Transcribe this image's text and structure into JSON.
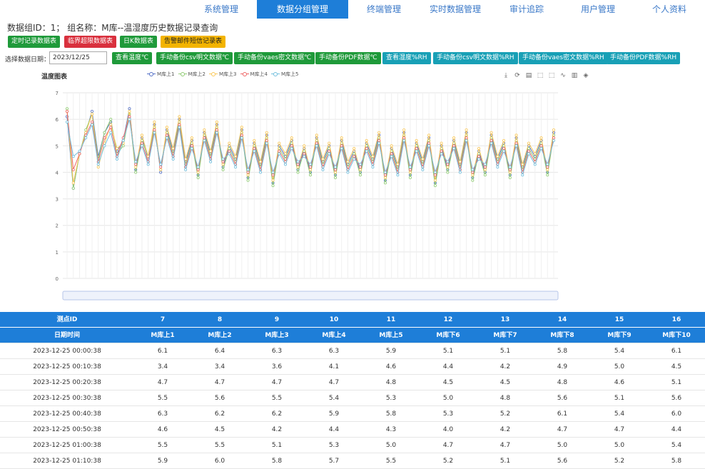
{
  "nav": [
    {
      "label": "系统管理",
      "active": false
    },
    {
      "label": "数据分组管理",
      "active": true
    },
    {
      "label": "终端管理",
      "active": false
    },
    {
      "label": "实时数据管理",
      "active": false
    },
    {
      "label": "审计追踪",
      "active": false
    },
    {
      "label": "用户管理",
      "active": false
    },
    {
      "label": "个人资料",
      "active": false
    }
  ],
  "header": {
    "title": "数据组ID：1；  组名称：M库--温湿度历史数据记录查询"
  },
  "buttons_row1": [
    {
      "label": "定时记录数据表",
      "color": "green"
    },
    {
      "label": "临界超限数据表",
      "color": "red"
    },
    {
      "label": "日K数据表",
      "color": "green"
    },
    {
      "label": "告警邮件短信记录表",
      "color": "yellow"
    }
  ],
  "date_label": "选择数据日期：",
  "date_value": "2023/12/25",
  "buttons_row2": [
    {
      "label": "查看温度℃",
      "color": "green"
    },
    {
      "label": "手动备份csv明文数据℃",
      "color": "green"
    },
    {
      "label": "手动备份vaes密文数据℃",
      "color": "green"
    },
    {
      "label": "手动备份PDF数据℃",
      "color": "green"
    },
    {
      "label": "查看湿度%RH",
      "color": "teal"
    },
    {
      "label": "手动备份csv明文数据%RH",
      "color": "teal"
    },
    {
      "label": "手动备份vaes密文数据%RH",
      "color": "teal"
    },
    {
      "label": "手动备份PDF数据%RH",
      "color": "teal"
    }
  ],
  "toolbox_icons": [
    "download-icon",
    "refresh-icon",
    "data-view-icon",
    "zoom-icon",
    "zoom-reset-icon",
    "line-chart-icon",
    "bar-chart-icon",
    "stack-icon"
  ],
  "chart_data": {
    "type": "line",
    "title": "温度图表",
    "ylim": [
      0,
      7
    ],
    "yticks": [
      0,
      1,
      2,
      3,
      4,
      5,
      6,
      7
    ],
    "grid": true,
    "legend_position": "top",
    "series": [
      {
        "name": "M库上1",
        "color": "#5470c6",
        "values": [
          6.1,
          3.4,
          4.7,
          5.5,
          6.3,
          4.6,
          5.5,
          5.9,
          4.8,
          5.2,
          6.4,
          4.1,
          5.3,
          4.5,
          5.8,
          4.0,
          5.6,
          4.8,
          6.0,
          4.4,
          5.2,
          3.9,
          5.5,
          4.7,
          5.8,
          4.2,
          5.0,
          4.5,
          5.6,
          3.8,
          5.1,
          4.3,
          5.4,
          3.6,
          5.0,
          4.6,
          5.2,
          4.1,
          4.9,
          4.0,
          5.3,
          4.4,
          5.0,
          3.9,
          5.2,
          4.3,
          4.8,
          4.0,
          5.1,
          4.5,
          5.4,
          3.7,
          4.9,
          4.2,
          5.5,
          3.9,
          5.1,
          4.4,
          5.3,
          3.6,
          5.0,
          4.1,
          5.2,
          4.3,
          5.5,
          3.8,
          4.8,
          4.0,
          5.4,
          4.5,
          5.1,
          3.9,
          5.3,
          4.2,
          5.0,
          4.6,
          5.2,
          4.0,
          5.5
        ]
      },
      {
        "name": "M库上2",
        "color": "#91cc75",
        "values": [
          6.4,
          3.4,
          4.7,
          5.6,
          6.2,
          4.5,
          5.5,
          6.0,
          4.7,
          5.0,
          6.2,
          4.0,
          5.2,
          4.6,
          5.7,
          4.1,
          5.5,
          4.7,
          5.9,
          4.3,
          5.1,
          3.8,
          5.4,
          4.6,
          5.7,
          4.1,
          4.9,
          4.4,
          5.5,
          3.7,
          5.0,
          4.2,
          5.3,
          3.5,
          4.9,
          4.5,
          5.1,
          4.0,
          4.8,
          3.9,
          5.2,
          4.3,
          4.9,
          3.8,
          5.1,
          4.2,
          4.7,
          3.9,
          5.0,
          4.4,
          5.3,
          3.6,
          4.8,
          4.1,
          5.4,
          3.8,
          5.0,
          4.3,
          5.2,
          3.5,
          4.9,
          4.0,
          5.1,
          4.2,
          5.4,
          3.7,
          4.7,
          3.9,
          5.3,
          4.4,
          5.0,
          3.8,
          5.2,
          4.1,
          4.9,
          4.5,
          5.1,
          3.9,
          5.4
        ]
      },
      {
        "name": "M库上3",
        "color": "#fac858",
        "values": [
          6.3,
          3.6,
          4.7,
          5.5,
          6.2,
          4.2,
          5.1,
          5.8,
          4.9,
          5.1,
          6.3,
          4.2,
          5.4,
          4.6,
          5.9,
          4.1,
          5.7,
          4.9,
          6.1,
          4.5,
          5.3,
          4.0,
          5.6,
          4.8,
          5.9,
          4.3,
          5.1,
          4.6,
          5.7,
          3.9,
          5.2,
          4.4,
          5.5,
          3.7,
          5.1,
          4.7,
          5.3,
          4.2,
          5.0,
          4.1,
          5.4,
          4.5,
          5.1,
          4.0,
          5.3,
          4.4,
          4.9,
          4.1,
          5.2,
          4.6,
          5.5,
          3.8,
          5.0,
          4.3,
          5.6,
          4.0,
          5.2,
          4.5,
          5.4,
          3.7,
          5.1,
          4.2,
          5.3,
          4.4,
          5.6,
          3.9,
          4.9,
          4.1,
          5.5,
          4.6,
          5.2,
          4.0,
          5.4,
          4.3,
          5.1,
          4.7,
          5.3,
          4.1,
          5.6
        ]
      },
      {
        "name": "M库上4",
        "color": "#ee6666",
        "values": [
          6.3,
          4.1,
          4.7,
          5.4,
          5.9,
          4.4,
          5.3,
          5.7,
          4.6,
          5.3,
          6.1,
          4.3,
          5.1,
          4.4,
          5.6,
          4.2,
          5.4,
          4.6,
          5.8,
          4.2,
          5.0,
          4.1,
          5.3,
          4.5,
          5.6,
          4.4,
          4.8,
          4.3,
          5.4,
          4.0,
          4.9,
          4.1,
          5.2,
          3.9,
          4.8,
          4.4,
          5.0,
          4.3,
          4.7,
          4.2,
          5.1,
          4.2,
          4.8,
          4.1,
          5.0,
          4.1,
          4.6,
          4.2,
          4.9,
          4.3,
          5.2,
          3.9,
          4.7,
          4.0,
          5.3,
          4.1,
          4.9,
          4.2,
          5.1,
          3.9,
          4.8,
          4.3,
          5.0,
          4.1,
          5.3,
          4.0,
          4.6,
          4.2,
          5.2,
          4.3,
          4.9,
          4.1,
          5.1,
          4.0,
          4.8,
          4.4,
          5.0,
          4.2,
          5.3
        ]
      },
      {
        "name": "M库上5",
        "color": "#73c0de",
        "values": [
          5.9,
          4.6,
          4.8,
          5.3,
          5.8,
          4.3,
          5.0,
          5.5,
          4.5,
          5.2,
          6.0,
          4.4,
          5.0,
          4.3,
          5.5,
          4.3,
          5.3,
          4.5,
          5.7,
          4.1,
          4.9,
          4.2,
          5.2,
          4.4,
          5.5,
          4.5,
          4.7,
          4.2,
          5.3,
          4.1,
          4.8,
          4.0,
          5.1,
          4.0,
          4.7,
          4.3,
          4.9,
          4.4,
          4.6,
          4.3,
          5.0,
          4.1,
          4.7,
          4.2,
          4.9,
          4.0,
          4.5,
          4.3,
          4.8,
          4.2,
          5.1,
          4.0,
          4.6,
          3.9,
          5.2,
          4.2,
          4.8,
          4.1,
          5.0,
          4.0,
          4.7,
          4.4,
          4.9,
          4.0,
          5.2,
          4.1,
          4.5,
          4.3,
          5.1,
          4.2,
          4.8,
          4.2,
          5.0,
          3.9,
          4.7,
          4.3,
          4.9,
          4.3,
          5.2
        ]
      }
    ]
  },
  "table": {
    "id_header_label": "测点ID",
    "ids": [
      "7",
      "8",
      "9",
      "10",
      "11",
      "12",
      "13",
      "14",
      "15",
      "16"
    ],
    "datetime_header_label": "日期时间",
    "names": [
      "M库上1",
      "M库上2",
      "M库上3",
      "M库上4",
      "M库上5",
      "M库下6",
      "M库下7",
      "M库下8",
      "M库下9",
      "M库下10"
    ],
    "rows": [
      {
        "time": "2023-12-25 00:00:38",
        "vals": [
          "6.1",
          "6.4",
          "6.3",
          "6.3",
          "5.9",
          "5.1",
          "5.1",
          "5.8",
          "5.4",
          "6.1"
        ]
      },
      {
        "time": "2023-12-25 00:10:38",
        "vals": [
          "3.4",
          "3.4",
          "3.6",
          "4.1",
          "4.6",
          "4.4",
          "4.2",
          "4.9",
          "5.0",
          "4.5"
        ]
      },
      {
        "time": "2023-12-25 00:20:38",
        "vals": [
          "4.7",
          "4.7",
          "4.7",
          "4.7",
          "4.8",
          "4.5",
          "4.5",
          "4.8",
          "4.6",
          "5.1"
        ]
      },
      {
        "time": "2023-12-25 00:30:38",
        "vals": [
          "5.5",
          "5.6",
          "5.5",
          "5.4",
          "5.3",
          "5.0",
          "4.8",
          "5.6",
          "5.1",
          "5.6"
        ]
      },
      {
        "time": "2023-12-25 00:40:38",
        "vals": [
          "6.3",
          "6.2",
          "6.2",
          "5.9",
          "5.8",
          "5.3",
          "5.2",
          "6.1",
          "5.4",
          "6.0"
        ]
      },
      {
        "time": "2023-12-25 00:50:38",
        "vals": [
          "4.6",
          "4.5",
          "4.2",
          "4.4",
          "4.3",
          "4.0",
          "4.2",
          "4.7",
          "4.7",
          "4.4"
        ]
      },
      {
        "time": "2023-12-25 01:00:38",
        "vals": [
          "5.5",
          "5.5",
          "5.1",
          "5.3",
          "5.0",
          "4.7",
          "4.7",
          "5.0",
          "5.0",
          "5.4"
        ]
      },
      {
        "time": "2023-12-25 01:10:38",
        "vals": [
          "5.9",
          "6.0",
          "5.8",
          "5.7",
          "5.5",
          "5.2",
          "5.1",
          "5.6",
          "5.2",
          "5.8"
        ]
      }
    ]
  }
}
